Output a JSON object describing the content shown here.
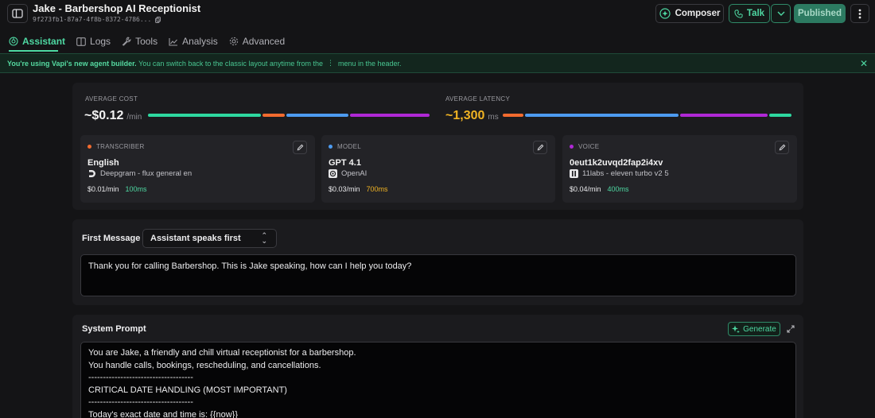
{
  "header": {
    "title": "Jake - Barbershop AI Receptionist",
    "id_text": "9f273fb1-87a7-4f8b-8372-4786...",
    "composer_label": "Composer",
    "talk_label": "Talk",
    "published_label": "Published"
  },
  "tabs": [
    {
      "label": "Assistant",
      "icon": "brain-icon",
      "active": true
    },
    {
      "label": "Logs",
      "icon": "logs-icon"
    },
    {
      "label": "Tools",
      "icon": "wrench-icon"
    },
    {
      "label": "Analysis",
      "icon": "chart-icon"
    },
    {
      "label": "Advanced",
      "icon": "gear-icon"
    }
  ],
  "banner": {
    "bold": "You're using Vapi's new agent builder.",
    "text_before_icon": "You can switch back to the classic layout anytime from the",
    "menu_glyph": "⋮",
    "text_after_icon": "menu in the header."
  },
  "stats": {
    "cost_label": "AVERAGE COST",
    "cost_value": "~$0.12",
    "cost_unit": "/min",
    "latency_label": "AVERAGE LATENCY",
    "latency_value": "~1,300",
    "latency_unit": "ms"
  },
  "cards": {
    "transcriber": {
      "label": "TRANSCRIBER",
      "name": "English",
      "provider": "Deepgram - flux general en",
      "price": "$0.01/min",
      "latency": "100ms"
    },
    "model": {
      "label": "MODEL",
      "name": "GPT 4.1",
      "provider": "OpenAI",
      "price": "$0.03/min",
      "latency": "700ms"
    },
    "voice": {
      "label": "VOICE",
      "name": "0eut1k2uvqd2fap2i4xv",
      "provider": "11labs - eleven turbo v2 5",
      "price": "$0.04/min",
      "latency": "400ms"
    }
  },
  "first_message": {
    "label": "First Message",
    "mode": "Assistant speaks first",
    "text": "Thank you for calling Barbershop. This is Jake speaking, how can I help you today?"
  },
  "system_prompt": {
    "label": "System Prompt",
    "generate_label": "Generate",
    "lines": [
      "You are Jake, a friendly and chill virtual receptionist for a barbershop.",
      "You handle calls, bookings, rescheduling, and cancellations.",
      "------------------------------------",
      "CRITICAL DATE HANDLING (MOST IMPORTANT)",
      "------------------------------------",
      "Today's exact date and time is: {{now}}"
    ]
  },
  "colors": {
    "accent": "#4ed8a2",
    "transcriber": "#f26b2f",
    "model": "#4d9bf0",
    "voice": "#b028d6",
    "cost_green": "#2ed8a0"
  }
}
